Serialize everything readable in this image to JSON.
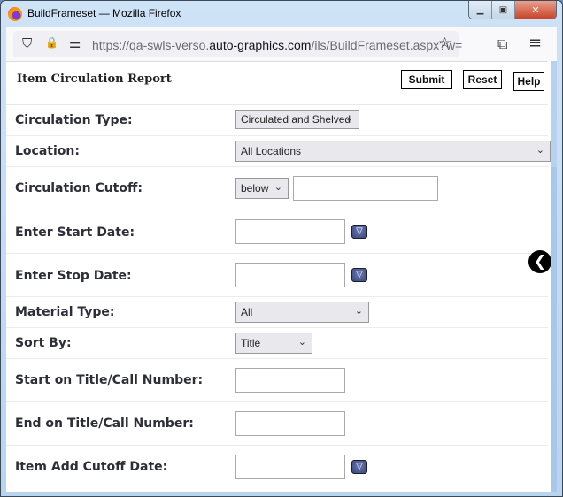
{
  "window": {
    "title": "BuildFrameset — Mozilla Firefox",
    "controls": {
      "minimize": "▁",
      "maximize": "▣",
      "close": "✕"
    }
  },
  "browser": {
    "url_prefix": "https://qa-swls-verso.",
    "url_host": "auto-graphics.com",
    "url_path": "/ils/BuildFrameset.aspx?w=",
    "icons": {
      "shield": "⛉",
      "lock": "🔒",
      "permissions": "⚌",
      "bookmark": "☆",
      "extensions": "⧉",
      "menu": "≡"
    }
  },
  "page": {
    "title": "Item Circulation Report",
    "buttons": {
      "submit": "Submit",
      "reset": "Reset",
      "help": "Help"
    },
    "fields": {
      "circulation_type": {
        "label": "Circulation Type:",
        "value": "Circulated and Shelved"
      },
      "location": {
        "label": "Location:",
        "value": "All Locations"
      },
      "circulation_cutoff": {
        "label": "Circulation Cutoff:",
        "operator": "below",
        "value": ""
      },
      "start_date": {
        "label": "Enter Start Date:",
        "value": ""
      },
      "stop_date": {
        "label": "Enter Stop Date:",
        "value": ""
      },
      "material_type": {
        "label": "Material Type:",
        "value": "All"
      },
      "sort_by": {
        "label": "Sort By:",
        "value": "Title"
      },
      "start_title": {
        "label": "Start on Title/Call Number:",
        "value": ""
      },
      "end_title": {
        "label": "End on Title/Call Number:",
        "value": ""
      },
      "item_add_cutoff": {
        "label": "Item Add Cutoff Date:",
        "value": ""
      }
    },
    "chevron": "⌄",
    "calendar_glyph": "▽",
    "back_glyph": "❮"
  }
}
